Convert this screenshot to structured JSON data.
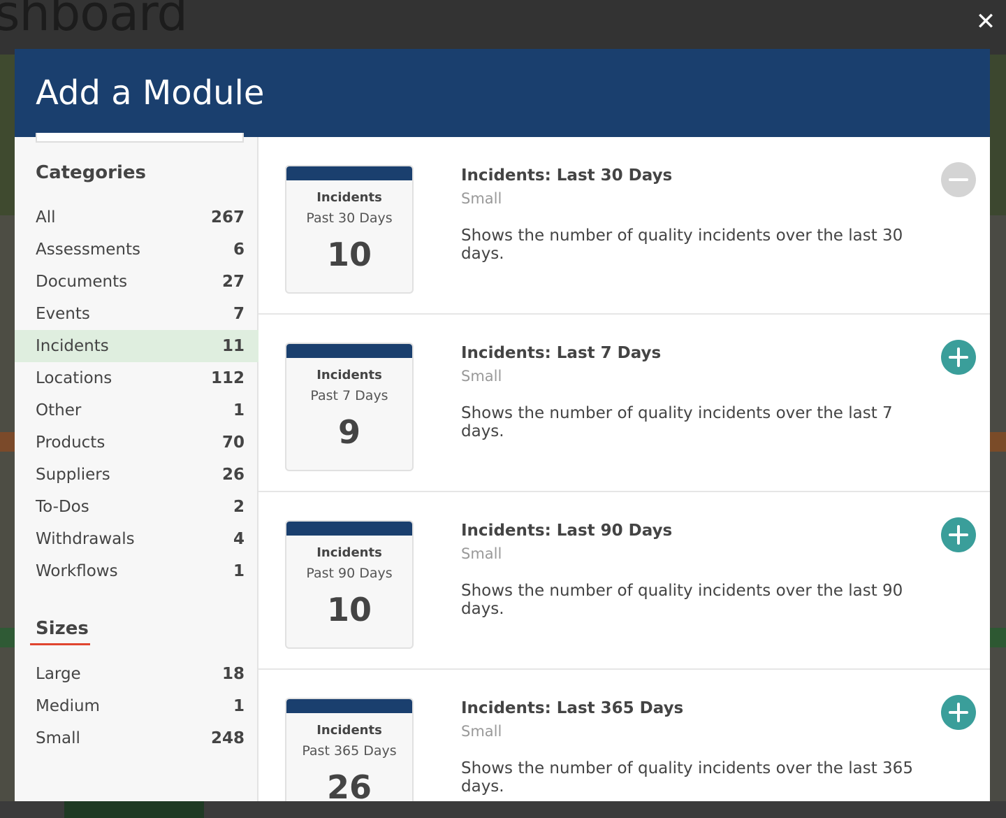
{
  "background": {
    "page_title": "shboard"
  },
  "modal": {
    "title": "Add a Module",
    "close_icon": "close-icon"
  },
  "sidebar": {
    "categories_title": "Categories",
    "categories": [
      {
        "label": "All",
        "count": "267"
      },
      {
        "label": "Assessments",
        "count": "6"
      },
      {
        "label": "Documents",
        "count": "27"
      },
      {
        "label": "Events",
        "count": "7"
      },
      {
        "label": "Incidents",
        "count": "11",
        "active": true
      },
      {
        "label": "Locations",
        "count": "112"
      },
      {
        "label": "Other",
        "count": "1"
      },
      {
        "label": "Products",
        "count": "70"
      },
      {
        "label": "Suppliers",
        "count": "26"
      },
      {
        "label": "To-Dos",
        "count": "2"
      },
      {
        "label": "Withdrawals",
        "count": "4"
      },
      {
        "label": "Workflows",
        "count": "1"
      }
    ],
    "sizes_title": "Sizes",
    "sizes": [
      {
        "label": "Large",
        "count": "18"
      },
      {
        "label": "Medium",
        "count": "1"
      },
      {
        "label": "Small",
        "count": "248"
      }
    ]
  },
  "modules": [
    {
      "preview": {
        "title": "Incidents",
        "subtitle": "Past 30 Days",
        "value": "10"
      },
      "name": "Incidents: Last 30 Days",
      "size": "Small",
      "description": "Shows the number of quality incidents over the last 30 days.",
      "action": "remove"
    },
    {
      "preview": {
        "title": "Incidents",
        "subtitle": "Past 7 Days",
        "value": "9"
      },
      "name": "Incidents: Last 7 Days",
      "size": "Small",
      "description": "Shows the number of quality incidents over the last 7 days.",
      "action": "add"
    },
    {
      "preview": {
        "title": "Incidents",
        "subtitle": "Past 90 Days",
        "value": "10"
      },
      "name": "Incidents: Last 90 Days",
      "size": "Small",
      "description": "Shows the number of quality incidents over the last 90 days.",
      "action": "add"
    },
    {
      "preview": {
        "title": "Incidents",
        "subtitle": "Past 365 Days",
        "value": "26"
      },
      "name": "Incidents: Last 365 Days",
      "size": "Small",
      "description": "Shows the number of quality incidents over the last 365 days.",
      "action": "add"
    }
  ],
  "colors": {
    "header": "#1a3f6e",
    "active_category": "#dfeedf",
    "add_button": "#3a9e9a",
    "remove_button": "#d4d4d4",
    "sizes_underline": "#e0452f"
  }
}
